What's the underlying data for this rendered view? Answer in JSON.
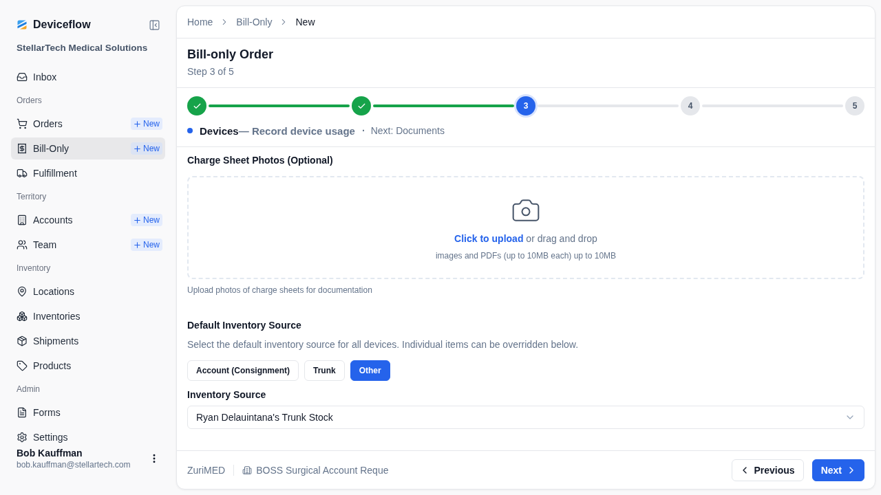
{
  "sidebar": {
    "brand": "Deviceflow",
    "organization": "StellarTech Medical Solutions",
    "sections": [
      {
        "items": [
          {
            "label": "Inbox",
            "selected": false
          }
        ]
      },
      {
        "title": "Orders",
        "items": [
          {
            "label": "Orders",
            "badge": "New",
            "selected": false
          },
          {
            "label": "Bill-Only",
            "badge": "New",
            "selected": true
          },
          {
            "label": "Fulfillment",
            "selected": false
          }
        ]
      },
      {
        "title": "Territory",
        "items": [
          {
            "label": "Accounts",
            "badge": "New",
            "selected": false
          },
          {
            "label": "Team",
            "badge": "New",
            "selected": false
          }
        ]
      },
      {
        "title": "Inventory",
        "items": [
          {
            "label": "Locations",
            "selected": false
          },
          {
            "label": "Inventories",
            "selected": false
          },
          {
            "label": "Shipments",
            "selected": false
          },
          {
            "label": "Products",
            "selected": false
          }
        ]
      },
      {
        "title": "Admin",
        "items": [
          {
            "label": "Forms",
            "selected": false
          },
          {
            "label": "Settings",
            "selected": false
          }
        ]
      }
    ],
    "user": {
      "name": "Bob Kauffman",
      "email": "bob.kauffman@stellartech.com"
    }
  },
  "breadcrumbs": [
    {
      "label": "Home",
      "current": false
    },
    {
      "label": "Bill-Only",
      "current": false
    },
    {
      "label": "New",
      "current": true
    }
  ],
  "header": {
    "title": "Bill-only Order",
    "subtitle": "Step 3 of 5"
  },
  "stepper": {
    "steps": [
      {
        "done": true
      },
      {
        "done": true
      },
      {
        "done": false,
        "selected": true,
        "number": "3"
      },
      {
        "done": false,
        "selected": false,
        "number": "4"
      },
      {
        "done": false,
        "selected": false,
        "number": "5"
      }
    ],
    "current": {
      "name": "Devices",
      "description": "— Record device usage",
      "separator": "·",
      "next": "Next: Documents"
    }
  },
  "upload": {
    "label": "Charge Sheet Photos (Optional)",
    "link": "Click to upload",
    "text": "or drag and drop",
    "limits": "images and PDFs (up to 10MB each) up to 10MB",
    "help": "Upload photos of charge sheets for documentation"
  },
  "inventory_source": {
    "title": "Default Inventory Source",
    "description": "Select the default inventory source for all devices. Individual items can be overridden below.",
    "options": [
      {
        "label": "Account (Consignment)",
        "selected": false
      },
      {
        "label": "Trunk",
        "selected": false
      },
      {
        "label": "Other",
        "selected": true
      }
    ],
    "field_label": "Inventory Source",
    "value": "Ryan Delauintana's Trunk Stock"
  },
  "footer": {
    "account": "ZuriMED",
    "request": "BOSS Surgical Account Reque",
    "buttons": [
      {
        "label": "Previous",
        "kind": "secondary"
      },
      {
        "label": "Next",
        "kind": "primary"
      }
    ]
  }
}
